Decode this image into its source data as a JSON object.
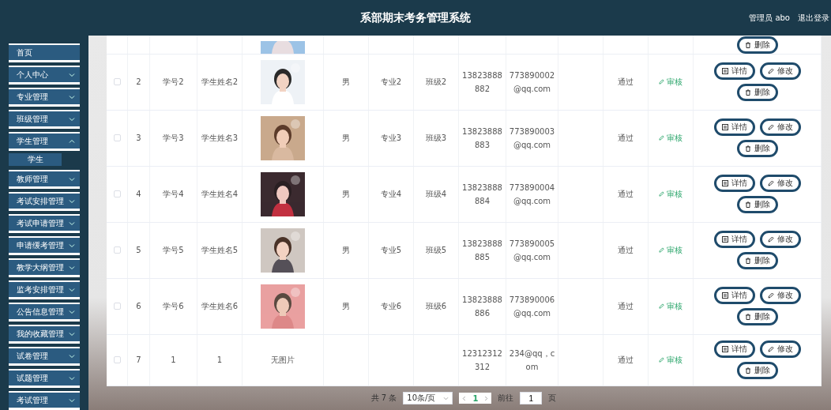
{
  "header": {
    "title": "系部期末考务管理系统",
    "user": "管理员 abo",
    "logout": "退出登录"
  },
  "menu": [
    {
      "label": "首页",
      "has_children": false
    },
    {
      "label": "个人中心",
      "has_children": true,
      "expanded": false
    },
    {
      "label": "专业管理",
      "has_children": true,
      "expanded": false
    },
    {
      "label": "班级管理",
      "has_children": true,
      "expanded": false
    },
    {
      "label": "学生管理",
      "has_children": true,
      "expanded": true,
      "children": [
        {
          "label": "学生"
        }
      ]
    },
    {
      "label": "教师管理",
      "has_children": true,
      "expanded": false
    },
    {
      "label": "考试安排管理",
      "has_children": true,
      "expanded": false
    },
    {
      "label": "考试申请管理",
      "has_children": true,
      "expanded": false
    },
    {
      "label": "申请缓考管理",
      "has_children": true,
      "expanded": false
    },
    {
      "label": "教学大纲管理",
      "has_children": true,
      "expanded": false
    },
    {
      "label": "监考安排管理",
      "has_children": true,
      "expanded": false
    },
    {
      "label": "公告信息管理",
      "has_children": true,
      "expanded": false
    },
    {
      "label": "我的收藏管理",
      "has_children": true,
      "expanded": false
    },
    {
      "label": "试卷管理",
      "has_children": true,
      "expanded": false
    },
    {
      "label": "试题管理",
      "has_children": true,
      "expanded": false
    },
    {
      "label": "考试管理",
      "has_children": true,
      "expanded": false
    }
  ],
  "table": {
    "rows": [
      {
        "kind": "partial",
        "actions": [
          "删除"
        ]
      },
      {
        "kind": "full",
        "checked": false,
        "index": "2",
        "student_no": "学号2",
        "name": "学生姓名2",
        "gender": "男",
        "major": "专业2",
        "class": "班级2",
        "phone": "13823888882",
        "email": "773890002@qq.com",
        "status": "通过",
        "review": "审核",
        "actions": [
          "详情",
          "修改",
          "删除"
        ]
      },
      {
        "kind": "full",
        "checked": false,
        "index": "3",
        "student_no": "学号3",
        "name": "学生姓名3",
        "gender": "男",
        "major": "专业3",
        "class": "班级3",
        "phone": "13823888883",
        "email": "773890003@qq.com",
        "status": "通过",
        "review": "审核",
        "actions": [
          "详情",
          "修改",
          "删除"
        ]
      },
      {
        "kind": "full",
        "checked": false,
        "index": "4",
        "student_no": "学号4",
        "name": "学生姓名4",
        "gender": "男",
        "major": "专业4",
        "class": "班级4",
        "phone": "13823888884",
        "email": "773890004@qq.com",
        "status": "通过",
        "review": "审核",
        "actions": [
          "详情",
          "修改",
          "删除"
        ]
      },
      {
        "kind": "full",
        "checked": false,
        "index": "5",
        "student_no": "学号5",
        "name": "学生姓名5",
        "gender": "男",
        "major": "专业5",
        "class": "班级5",
        "phone": "13823888885",
        "email": "773890005@qq.com",
        "status": "通过",
        "review": "审核",
        "actions": [
          "详情",
          "修改",
          "删除"
        ]
      },
      {
        "kind": "full",
        "checked": false,
        "index": "6",
        "student_no": "学号6",
        "name": "学生姓名6",
        "gender": "男",
        "major": "专业6",
        "class": "班级6",
        "phone": "13823888886",
        "email": "773890006@qq.com",
        "status": "通过",
        "review": "审核",
        "actions": [
          "详情",
          "修改",
          "删除"
        ]
      },
      {
        "kind": "full",
        "checked": false,
        "index": "7",
        "student_no": "1",
        "name": "1",
        "photo_text": "无图片",
        "phone": "12312312312",
        "email": "234@qq，com",
        "status": "通过",
        "review": "审核",
        "actions": [
          "详情",
          "修改",
          "删除"
        ]
      }
    ]
  },
  "pager": {
    "total": "共 7 条",
    "page_size": "10条/页",
    "pages": [
      {
        "label": "1",
        "selected": true
      }
    ],
    "goto_label": "前往",
    "goto_value": "1",
    "goto_suffix": "页"
  }
}
